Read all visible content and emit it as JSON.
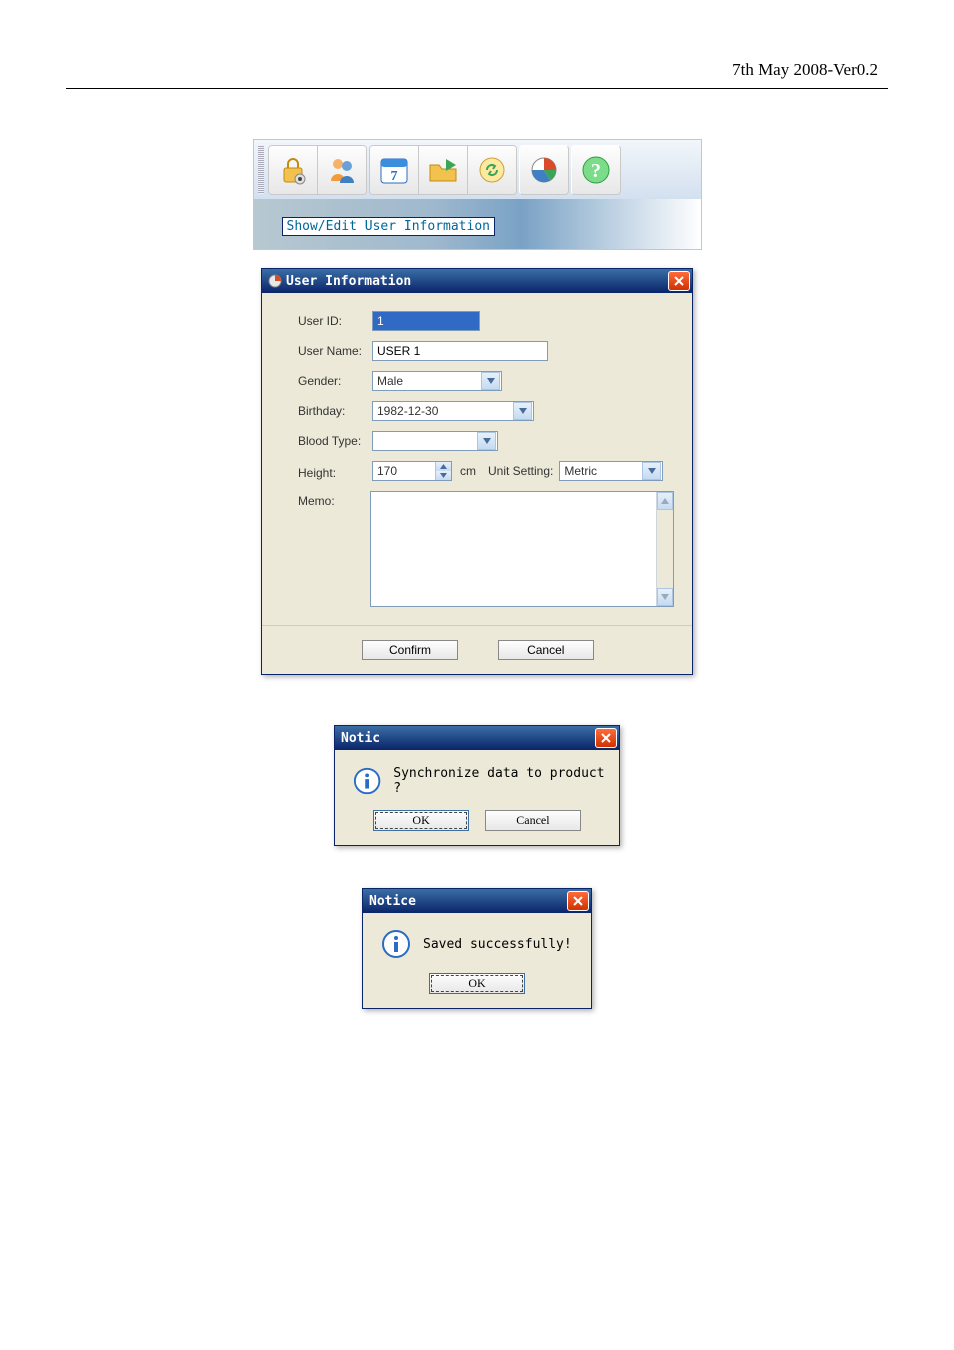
{
  "page_header": "7th May 2008-Ver0.2",
  "toolbar": {
    "tooltip": "Show/Edit User Information",
    "buttons": {
      "lock": "lock-icon",
      "user": "users-icon",
      "calendar": "calendar-icon",
      "calendar_day": "7",
      "folder": "folder-arrow-icon",
      "sync": "sync-icon",
      "pie": "pie-chart-icon",
      "help": "help-icon"
    }
  },
  "user_info": {
    "window_title": "User Information",
    "labels": {
      "user_id": "User ID:",
      "user_name": "User Name:",
      "gender": "Gender:",
      "birthday": "Birthday:",
      "blood_type": "Blood Type:",
      "height": "Height:",
      "unit_setting": "Unit Setting:",
      "memo": "Memo:"
    },
    "values": {
      "user_id": "1",
      "user_name": "USER 1",
      "gender": "Male",
      "birthday": "1982-12-30",
      "blood_type": "",
      "height": "170",
      "height_unit": "cm",
      "unit_setting": "Metric",
      "memo": ""
    },
    "buttons": {
      "confirm": "Confirm",
      "cancel": "Cancel"
    }
  },
  "notice1": {
    "title": "Notic",
    "message": "Synchronize data to product ?",
    "ok": "OK",
    "cancel": "Cancel"
  },
  "notice2": {
    "title": "Notice",
    "message": "Saved successfully!",
    "ok": "OK"
  }
}
